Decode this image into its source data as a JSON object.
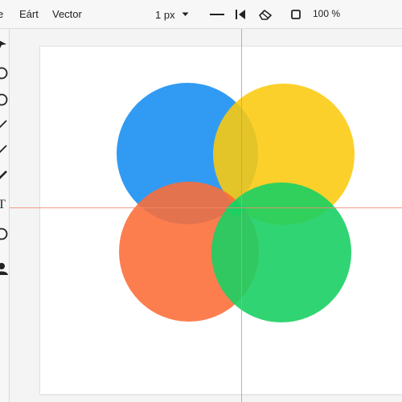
{
  "menu": {
    "items": [
      "e",
      "Eárt",
      "Vector"
    ]
  },
  "toolbar": {
    "stroke_width": "1 px",
    "zoom": "100 %"
  },
  "tools": {
    "text_tool_glyph": "T"
  },
  "colors": {
    "blue": "#1f93f2",
    "yellow": "#fcc90d",
    "red_orange": "#fc6c37",
    "green": "#1bcf63",
    "guide": "#f08a72"
  },
  "icons": {
    "dropdown": "chevron-down-icon",
    "line": "line-style-icon",
    "arrow": "arrowhead-icon",
    "eraser": "eraser-icon",
    "fill": "fill-square-icon"
  }
}
